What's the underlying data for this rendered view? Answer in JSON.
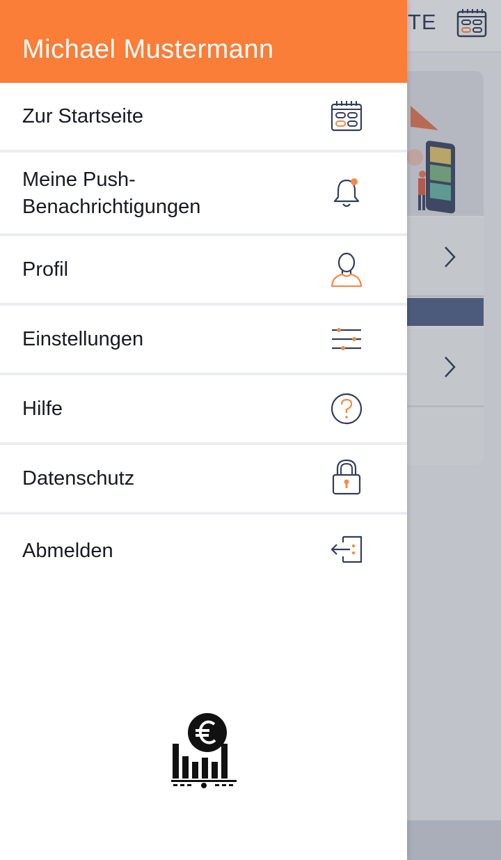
{
  "background": {
    "topbar_fragment": "TE",
    "accent": "#fa7d38",
    "navy": "#343d58"
  },
  "drawer": {
    "user_name": "Michael Mustermann",
    "menu": [
      {
        "label": "Zur Startseite",
        "icon": "calendar-icon"
      },
      {
        "label": "Meine Push-\nBenachrichtigungen",
        "icon": "bell-icon"
      },
      {
        "label": "Profil",
        "icon": "profile-icon"
      },
      {
        "label": "Einstellungen",
        "icon": "sliders-icon"
      },
      {
        "label": "Hilfe",
        "icon": "help-icon"
      },
      {
        "label": "Datenschutz",
        "icon": "lock-icon"
      },
      {
        "label": "Abmelden",
        "icon": "logout-icon"
      }
    ],
    "logo": "euro-chart-logo"
  }
}
